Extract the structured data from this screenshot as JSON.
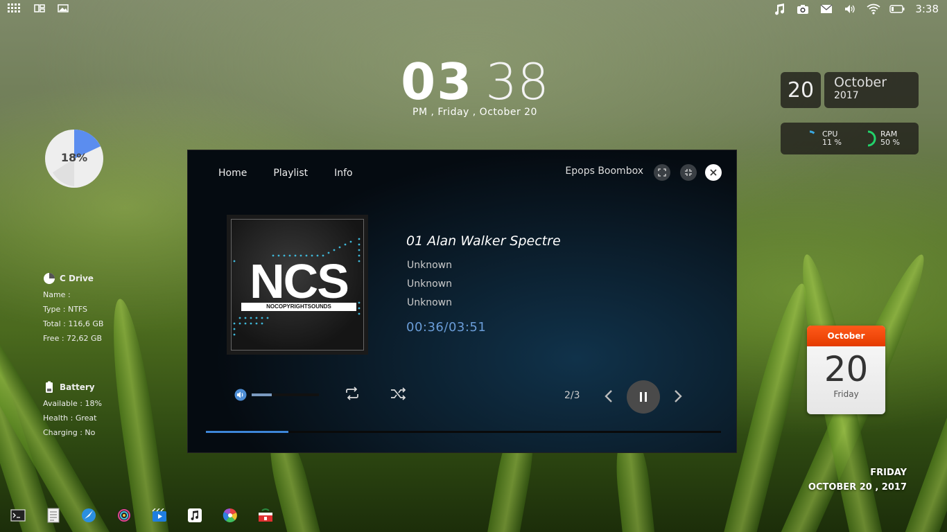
{
  "topbar": {
    "time": "3:38",
    "left_icons": [
      "apps-grid-icon",
      "window-tiles-icon",
      "image-icon"
    ],
    "right_icons": [
      "music-icon",
      "camera-icon",
      "mail-icon",
      "volume-icon",
      "wifi-icon",
      "battery-icon"
    ]
  },
  "clock": {
    "hour": "03",
    "minute": "38",
    "line": "PM , Friday , October 20"
  },
  "date_widget": {
    "day": "20",
    "month": "October",
    "year": "2017"
  },
  "system": {
    "cpu_label": "CPU",
    "cpu_value": "11 %",
    "cpu_fraction": 0.11,
    "ram_label": "RAM",
    "ram_value": "50 %",
    "ram_fraction": 0.5,
    "cpu_color": "#3aa7e0",
    "ram_color": "#22d36a"
  },
  "disk_usage": {
    "label": "18%",
    "fraction": 0.18,
    "color": "#5b8def"
  },
  "drive": {
    "title": "C Drive",
    "name": "Name :",
    "type": "Type : NTFS",
    "total": "Total : 116,6 GB",
    "free": "Free : 72,62 GB"
  },
  "battery": {
    "title": "Battery",
    "available": "Available : 18%",
    "health": "Health : Great",
    "charging": "Charging : No"
  },
  "player": {
    "nav": [
      "Home",
      "Playlist",
      "Info"
    ],
    "title": "Epops Boombox",
    "album_art_text": "NCS",
    "album_art_subtext": "NOCOPYRIGHTSOUNDS",
    "track": "01 Alan Walker Spectre",
    "artist": "Unknown",
    "album": "Unknown",
    "genre": "Unknown",
    "time": "00:36/03:51",
    "volume_fraction": 0.3,
    "progress_fraction": 0.16,
    "position": "2/3",
    "accent": "#3d86d8"
  },
  "calendar": {
    "month": "October",
    "day": "20",
    "weekday": "Friday"
  },
  "bottom_date": {
    "line1": "FRIDAY",
    "line2": "OCTOBER 20 , 2017"
  },
  "dock": [
    "terminal-icon",
    "text-editor-icon",
    "browser-icon",
    "media-disc-icon",
    "video-player-icon",
    "music-player-icon",
    "color-picker-icon",
    "app-store-icon"
  ]
}
